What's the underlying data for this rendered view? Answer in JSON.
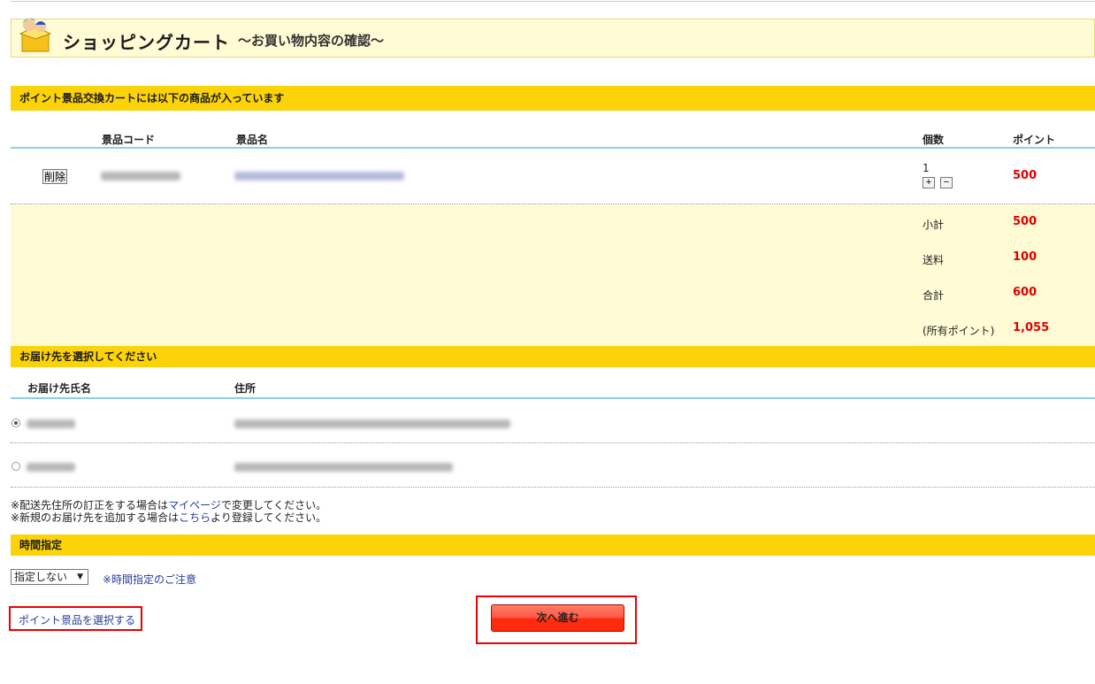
{
  "header": {
    "title": "ショッピングカート",
    "subtitle": "～お買い物内容の確認～"
  },
  "cart": {
    "section_title": "ポイント景品交換カートには以下の商品が入っています",
    "columns": {
      "code": "景品コード",
      "name": "景品名",
      "quantity": "個数",
      "points": "ポイント"
    },
    "item": {
      "delete_label": "削除",
      "quantity": "1",
      "plus": "+",
      "minus": "−",
      "points": "500"
    },
    "summary": {
      "subtotal_label": "小計",
      "subtotal": "500",
      "shipping_label": "送料",
      "shipping": "100",
      "total_label": "合計",
      "total": "600",
      "owned_label": "(所有ポイント)",
      "owned": "1,055"
    }
  },
  "delivery": {
    "section_title": "お届け先を選択してください",
    "columns": {
      "name": "お届け先氏名",
      "address": "住所"
    },
    "notes": {
      "line1_prefix": "※配送先住所の訂正をする場合は",
      "line1_link": "マイページ",
      "line1_suffix": "で変更してください。",
      "line2_prefix": "※新規のお届け先を追加する場合は",
      "line2_link": "こちら",
      "line2_suffix": "より登録してください。"
    }
  },
  "time": {
    "section_title": "時間指定",
    "selected": "指定しない",
    "notice_link": "※時間指定のご注意"
  },
  "footer": {
    "back_link": "ポイント景品を選択する",
    "next_button": "次へ進む"
  },
  "colors": {
    "bar": "#fcd309",
    "summary_bg": "#fffbd4",
    "points_red": "#e00000",
    "highlight_box": "#e00000"
  }
}
